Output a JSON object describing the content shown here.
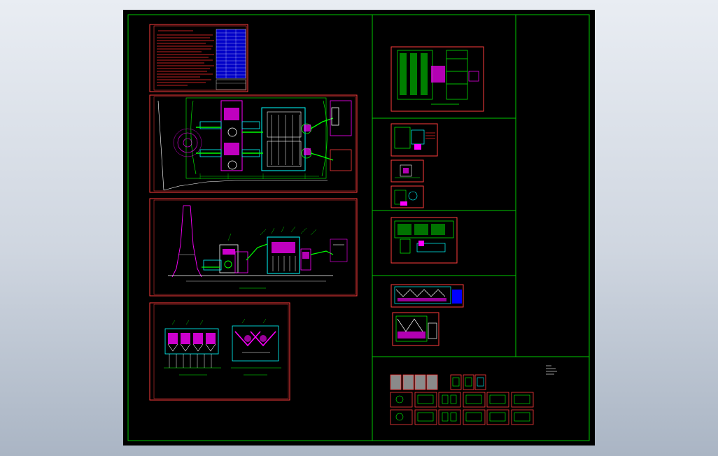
{
  "viewport": {
    "background": "#000000",
    "frame_color": "#00c800",
    "sheet_border_color": "#ff3c3c"
  },
  "palette": {
    "green": "#00ff00",
    "cyan": "#00ffff",
    "magenta": "#ff00ff",
    "yellow": "#ffff00",
    "white": "#ffffff",
    "blue": "#0000ff",
    "red": "#ff2a2a",
    "gray": "#8a8a8a"
  },
  "sheets": {
    "notes": "general-notes-sheet",
    "site_plan": "site-plan-sheet",
    "elevation": "elevation-sheet",
    "section": "section-sheet"
  }
}
